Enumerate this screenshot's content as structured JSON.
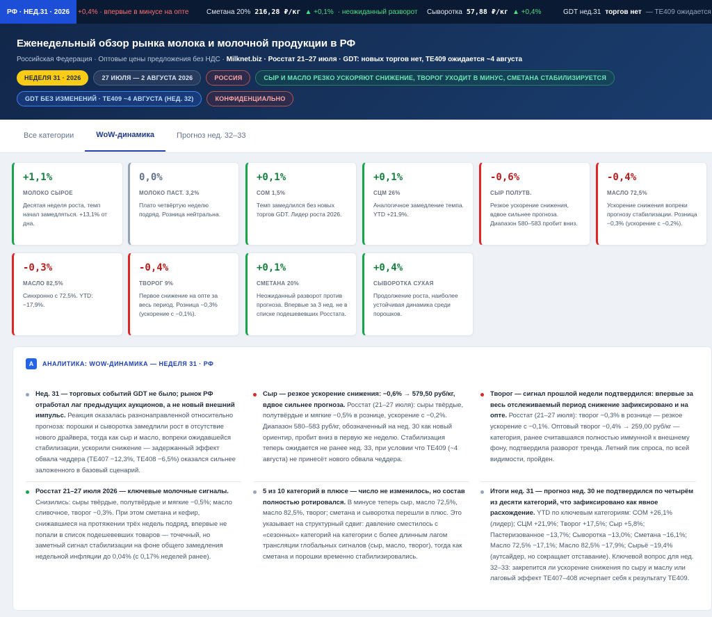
{
  "ticker": {
    "badge": "РФ · НЕД.31 · 2026",
    "items": [
      {
        "text": "+0,4% · впервые в минусе на опте",
        "kind": "dn"
      },
      {
        "name": "Сметана 20%",
        "price": "216,28 ₽/кг",
        "change": "▲ +0,1%",
        "note": "· неожиданный разворот"
      },
      {
        "name": "Сыворотка",
        "price": "57,88 ₽/кг",
        "change": "▲ +0,4%"
      },
      {
        "name": "GDT нед.31",
        "price": "торгов нет",
        "note": "— TE409 ожидается"
      }
    ]
  },
  "hero": {
    "title": "Еженедельный обзор рынка молока и молочной продукции в РФ",
    "meta_prefix": "Российская Федерация · Оптовые цены предложения без НДС · ",
    "meta_bold": "Milknet.biz · Росстат 21–27 июля · GDT: новых торгов нет, TE409 ожидается ~4 августа",
    "chips": [
      {
        "label": "НЕДЕЛЯ 31 · 2026",
        "style": "yellow"
      },
      {
        "label": "27 ИЮЛЯ — 2 АВГУСТА 2026",
        "style": "dark"
      },
      {
        "label": "РОССИЯ",
        "style": "red"
      },
      {
        "label": "СЫР И МАСЛО РЕЗКО УСКОРЯЮТ СНИЖЕНИЕ, ТВОРОГ УХОДИТ В МИНУС, СМЕТАНА СТАБИЛИЗИРУЕТСЯ",
        "style": "green"
      },
      {
        "label": "GDT БЕЗ ИЗМЕНЕНИЙ · TE409 ~4 АВГУСТА (НЕД. 32)",
        "style": "blue"
      },
      {
        "label": "КОНФИДЕНЦИАЛЬНО",
        "style": "red"
      }
    ]
  },
  "tabs": [
    {
      "label": "Все категории",
      "active": false
    },
    {
      "label": "WoW-динамика",
      "active": true
    },
    {
      "label": "Прогноз нед. 32–33",
      "active": false
    }
  ],
  "cards": [
    {
      "value": "+1,1%",
      "label": "МОЛОКО СЫРОЕ",
      "text": "Десятая неделя роста, темп начал замедляться. +13,1% от дна.",
      "tone": "pos"
    },
    {
      "value": "0,0%",
      "label": "МОЛОКО ПАСТ. 3,2%",
      "text": "Плато четвёртую неделю подряд. Розница нейтральна.",
      "tone": "neu"
    },
    {
      "value": "+0,1%",
      "label": "СОМ 1,5%",
      "text": "Темп замедлился без новых торгов GDT. Лидер роста 2026.",
      "tone": "pos"
    },
    {
      "value": "+0,1%",
      "label": "СЦМ 26%",
      "text": "Аналогичное замедление темпа. YTD +21,9%.",
      "tone": "pos"
    },
    {
      "value": "-0,6%",
      "label": "СЫР ПОЛУТВ.",
      "text": "Резкое ускорение снижения, вдвое сильнее прогноза. Диапазон 580–583 пробит вниз.",
      "tone": "neg"
    },
    {
      "value": "-0,4%",
      "label": "МАСЛО 72,5%",
      "text": "Ускорение снижения вопреки прогнозу стабилизации. Розница −0,3% (ускорение с −0,2%).",
      "tone": "neg"
    },
    {
      "value": "-0,3%",
      "label": "МАСЛО 82,5%",
      "text": "Синхронно с 72,5%. YTD: −17,9%.",
      "tone": "neg"
    },
    {
      "value": "-0,4%",
      "label": "ТВОРОГ 9%",
      "text": "Первое снижение на опте за весь период. Розница −0,3% (ускорение с −0,1%).",
      "tone": "neg"
    },
    {
      "value": "+0,1%",
      "label": "СМЕТАНА 20%",
      "text": "Неожиданный разворот против прогноза. Впервые за 3 нед. не в списке подешевевших Росстата.",
      "tone": "pos"
    },
    {
      "value": "+0,4%",
      "label": "СЫВОРОТКА СУХАЯ",
      "text": "Продолжение роста, наиболее устойчивая динамика среди порошков.",
      "tone": "pos"
    }
  ],
  "analysis": {
    "icon": "A",
    "title": "АНАЛИТИКА: WOW-ДИНАМИКА — НЕДЕЛЯ 31 · РФ",
    "items": [
      {
        "dot": "#94a3b8",
        "bold": "Нед. 31 — торговых событий GDT не было; рынок РФ отработал лаг предыдущих аукционов, а не новый внешний импульс.",
        "text": " Реакция оказалась разнонаправленной относительно прогноза: порошки и сыворотка замедлили рост в отсутствие нового драйвера, тогда как сыр и масло, вопреки ожидавшейся стабилизации, ускорили снижение — задержанный эффект обвала чеддера (TE407 −12,3%, TE408 −6,5%) оказался сильнее заложенного в базовый сценарий."
      },
      {
        "dot": "#dc2626",
        "bold": "Сыр — резкое ускорение снижения: −0,6% → 579,50 руб/кг, вдвое сильнее прогноза.",
        "text": " Росстат (21–27 июля): сыры твёрдые, полутвёрдые и мягкие −0,5% в рознице, ускорение с −0,2%. Диапазон 580–583 руб/кг, обозначенный на нед. 30 как новый ориентир, пробит вниз в первую же неделю. Стабилизация теперь ожидается не ранее нед. 33, при условии что TE409 (~4 августа) не принесёт нового обвала чеддера."
      },
      {
        "dot": "#dc2626",
        "bold": "Творог — сигнал прошлой недели подтвердился: впервые за весь отслеживаемый период снижение зафиксировано и на опте.",
        "text": " Росстат (21–27 июля): творог −0,3% в рознице — резкое ускорение с −0,1%. Оптовый творог −0,4% → 259,00 руб/кг — категория, ранее считавшаяся полностью иммунной к внешнему фону, подтвердила разворот тренда. Летний пик спроса, по всей видимости, пройден."
      },
      {
        "dot": "#16a34a",
        "bold": "Росстат 21–27 июля 2026 — ключевые молочные сигналы.",
        "text": " Снизились: сыры твёрдые, полутвёрдые и мягкие −0,5%; масло сливочное, творог −0,3%. При этом сметана и кефир, снижавшиеся на протяжении трёх недель подряд, впервые не попали в список подешевевших товаров — точечный, но заметный сигнал стабилизации на фоне общего замедления недельной инфляции до 0,04% (с 0,17% неделей ранее)."
      },
      {
        "dot": "#94a3b8",
        "bold": "5 из 10 категорий в плюсе — число не изменилось, но состав полностью ротировался.",
        "text": " В минусе теперь сыр, масло 72,5%, масло 82,5%, творог; сметана и сыворотка перешли в плюс. Это указывает на структурный сдвиг: давление сместилось с «сезонных» категорий на категории с более длинным лагом трансляции глобальных сигналов (сыр, масло, творог), тогда как сметана и порошки временно стабилизировались."
      },
      {
        "dot": "#94a3b8",
        "bold": "Итоги нед. 31 — прогноз нед. 30 не подтвердился по четырём из десяти категорий, что зафиксировано как явное расхождение.",
        "text": " YTD по ключевым категориям: СОМ +26,1% (лидер); СЦМ +21,9%; Творог +17,5%; Сыр +5,8%; Пастеризованное −13,7%; Сыворотка −13,0%; Сметана −16,1%; Масло 72,5% −17,1%; Масло 82,5% −17,9%; Сырьё −19,4% (аутсайдер, но сокращает отставание). Ключевой вопрос для нед. 32–33: закрепится ли ускорение снижения по сыру и маслу или лаговый эффект TE407–408 исчерпает себя к результату TE409."
      }
    ]
  }
}
